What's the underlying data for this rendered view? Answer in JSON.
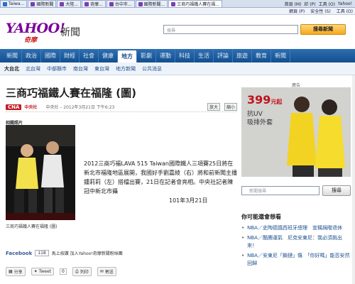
{
  "browser": {
    "tabs": [
      {
        "label": "Taiwa...",
        "active": false
      },
      {
        "label": "國際新聞",
        "active": false
      },
      {
        "label": "大陸...",
        "active": false
      },
      {
        "label": "奇摩...",
        "active": false
      },
      {
        "label": "台中市...",
        "active": false
      },
      {
        "label": "國際新聞...",
        "active": false
      },
      {
        "label": "三商巧福鐵人賽在福...",
        "active": true
      }
    ],
    "right_items": [
      "首頁 (M)",
      "印 (P)",
      "工具 (O)",
      "Yahoo!"
    ],
    "toolbar_items": [
      "網頁 (P)",
      "安全性 (S)",
      "工具 (O)"
    ]
  },
  "header": {
    "logo": "YAHOO!",
    "logo_sub": "奇摩",
    "section": "新聞",
    "search_placeholder": "搜尋",
    "search_button": "搜尋新聞"
  },
  "nav": {
    "items": [
      {
        "label": "新聞",
        "active": false
      },
      {
        "label": "政治",
        "active": false
      },
      {
        "label": "國際",
        "active": false
      },
      {
        "label": "財經",
        "active": false
      },
      {
        "label": "社會",
        "active": false
      },
      {
        "label": "健康",
        "active": false
      },
      {
        "label": "地方",
        "active": true
      },
      {
        "label": "影劇",
        "active": false
      },
      {
        "label": "運動",
        "active": false
      },
      {
        "label": "科技",
        "active": false
      },
      {
        "label": "生活",
        "active": false
      },
      {
        "label": "評論",
        "active": false
      },
      {
        "label": "旅遊",
        "active": false
      },
      {
        "label": "教育",
        "active": false
      },
      {
        "label": "新聞",
        "active": false
      }
    ]
  },
  "subnav": {
    "items": [
      {
        "label": "大台北",
        "bold": true
      },
      {
        "label": "北台灣",
        "bold": false
      },
      {
        "label": "中部縣市",
        "bold": false
      },
      {
        "label": "南台灣",
        "bold": false
      },
      {
        "label": "東台灣",
        "bold": false
      },
      {
        "label": "地方新聞",
        "bold": false
      },
      {
        "label": "公共消息",
        "bold": false
      }
    ]
  },
  "article": {
    "title": "三商巧福鐵人賽在福隆 (圖)",
    "source_badge": "CNA",
    "source_name": "中央社",
    "byline": "中央社 – 2012年3月21日 下午6:23",
    "zoom_in": "放大",
    "zoom_out": "縮小",
    "photo_heading": "相關照片",
    "photo_caption": "三商巧福鐵人賽在福隆 (圖)",
    "paragraph": "2012三商巧福LAVA 515 Taiwan國際鐵人三項賽25日將在新北市福隆地區展開，我國好手劉嘉綾（右）將和前新聞主播鍾莉莉（左）搭檔出賽，21日在記者會亮相。中央社記者陳冠中新北市攝",
    "dateline": "101年3月21日"
  },
  "facebook": {
    "label": "Facebook",
    "count": "118",
    "text": "馬上按讚 加入Yahoo!奇摩新聞粉絲團"
  },
  "share": {
    "tweet_label": "Tweet",
    "tweet_count": "0",
    "share_label": "分享",
    "print_label": "列印",
    "email_label": "寄送"
  },
  "sidebar": {
    "ad_label": "廣告",
    "ad_price": "399",
    "ad_unit": "元起",
    "ad_line1": "抗UV",
    "ad_line2": "吸排外套",
    "search_placeholder": "新聞搜尋",
    "search_button": "搜尋",
    "like_heading": "你可能還會想看",
    "like_items": [
      "NBA／史陶德諷西班牙總理　宣稱捐贈退休",
      "NBA／酷團運氣　尼克安東尼：我必須挑出來！",
      "NBA／安東尼「鎖鏈」傷　「你好嗎」能否安然回歸"
    ]
  },
  "colors": {
    "brand": "#7b0099",
    "nav_bg": "#1b5a9c",
    "headline": "#222222",
    "accent_red": "#c1121f"
  }
}
